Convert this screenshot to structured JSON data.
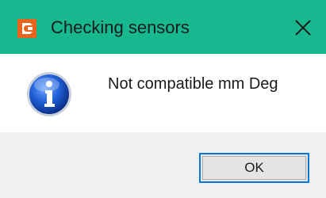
{
  "window": {
    "title": "Checking sensors",
    "close_icon": "close-icon",
    "app_icon": "app-logo-icon",
    "accent_color": "#17b890"
  },
  "dialog": {
    "icon": "info-icon",
    "message": "Not compatible mm Deg",
    "ok_label": "OK"
  }
}
